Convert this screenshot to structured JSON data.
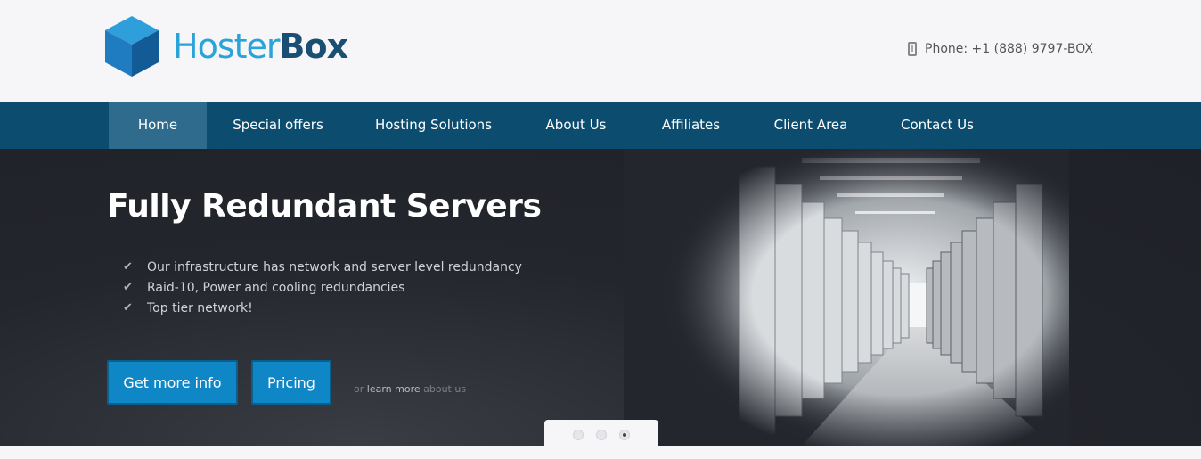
{
  "header": {
    "logo": {
      "part1": "Hoster",
      "part2": "Box"
    },
    "phone": {
      "icon": "phone-icon",
      "text": "Phone: +1 (888) 9797-BOX"
    }
  },
  "nav": {
    "items": [
      {
        "label": "Home",
        "active": true
      },
      {
        "label": "Special offers"
      },
      {
        "label": "Hosting Solutions"
      },
      {
        "label": "About Us"
      },
      {
        "label": "Affiliates"
      },
      {
        "label": "Client Area"
      },
      {
        "label": "Contact Us"
      }
    ]
  },
  "hero": {
    "title": "Fully Redundant Servers",
    "features": [
      "Our infrastructure has network and server level redundancy",
      "Raid-10, Power and cooling redundancies",
      "Top tier network!"
    ],
    "buttons": {
      "more_info": "Get more info",
      "pricing": "Pricing"
    },
    "learn": {
      "prefix": "or",
      "link1": "learn more",
      "link2": "about us"
    }
  },
  "slider": {
    "count": 3,
    "active": 3
  },
  "colors": {
    "nav": "#0c4d6f",
    "nav_active": "#2e6b8d",
    "button": "#0f86c6",
    "logo_light": "#2aa3d9",
    "logo_dark": "#1a4f73"
  }
}
